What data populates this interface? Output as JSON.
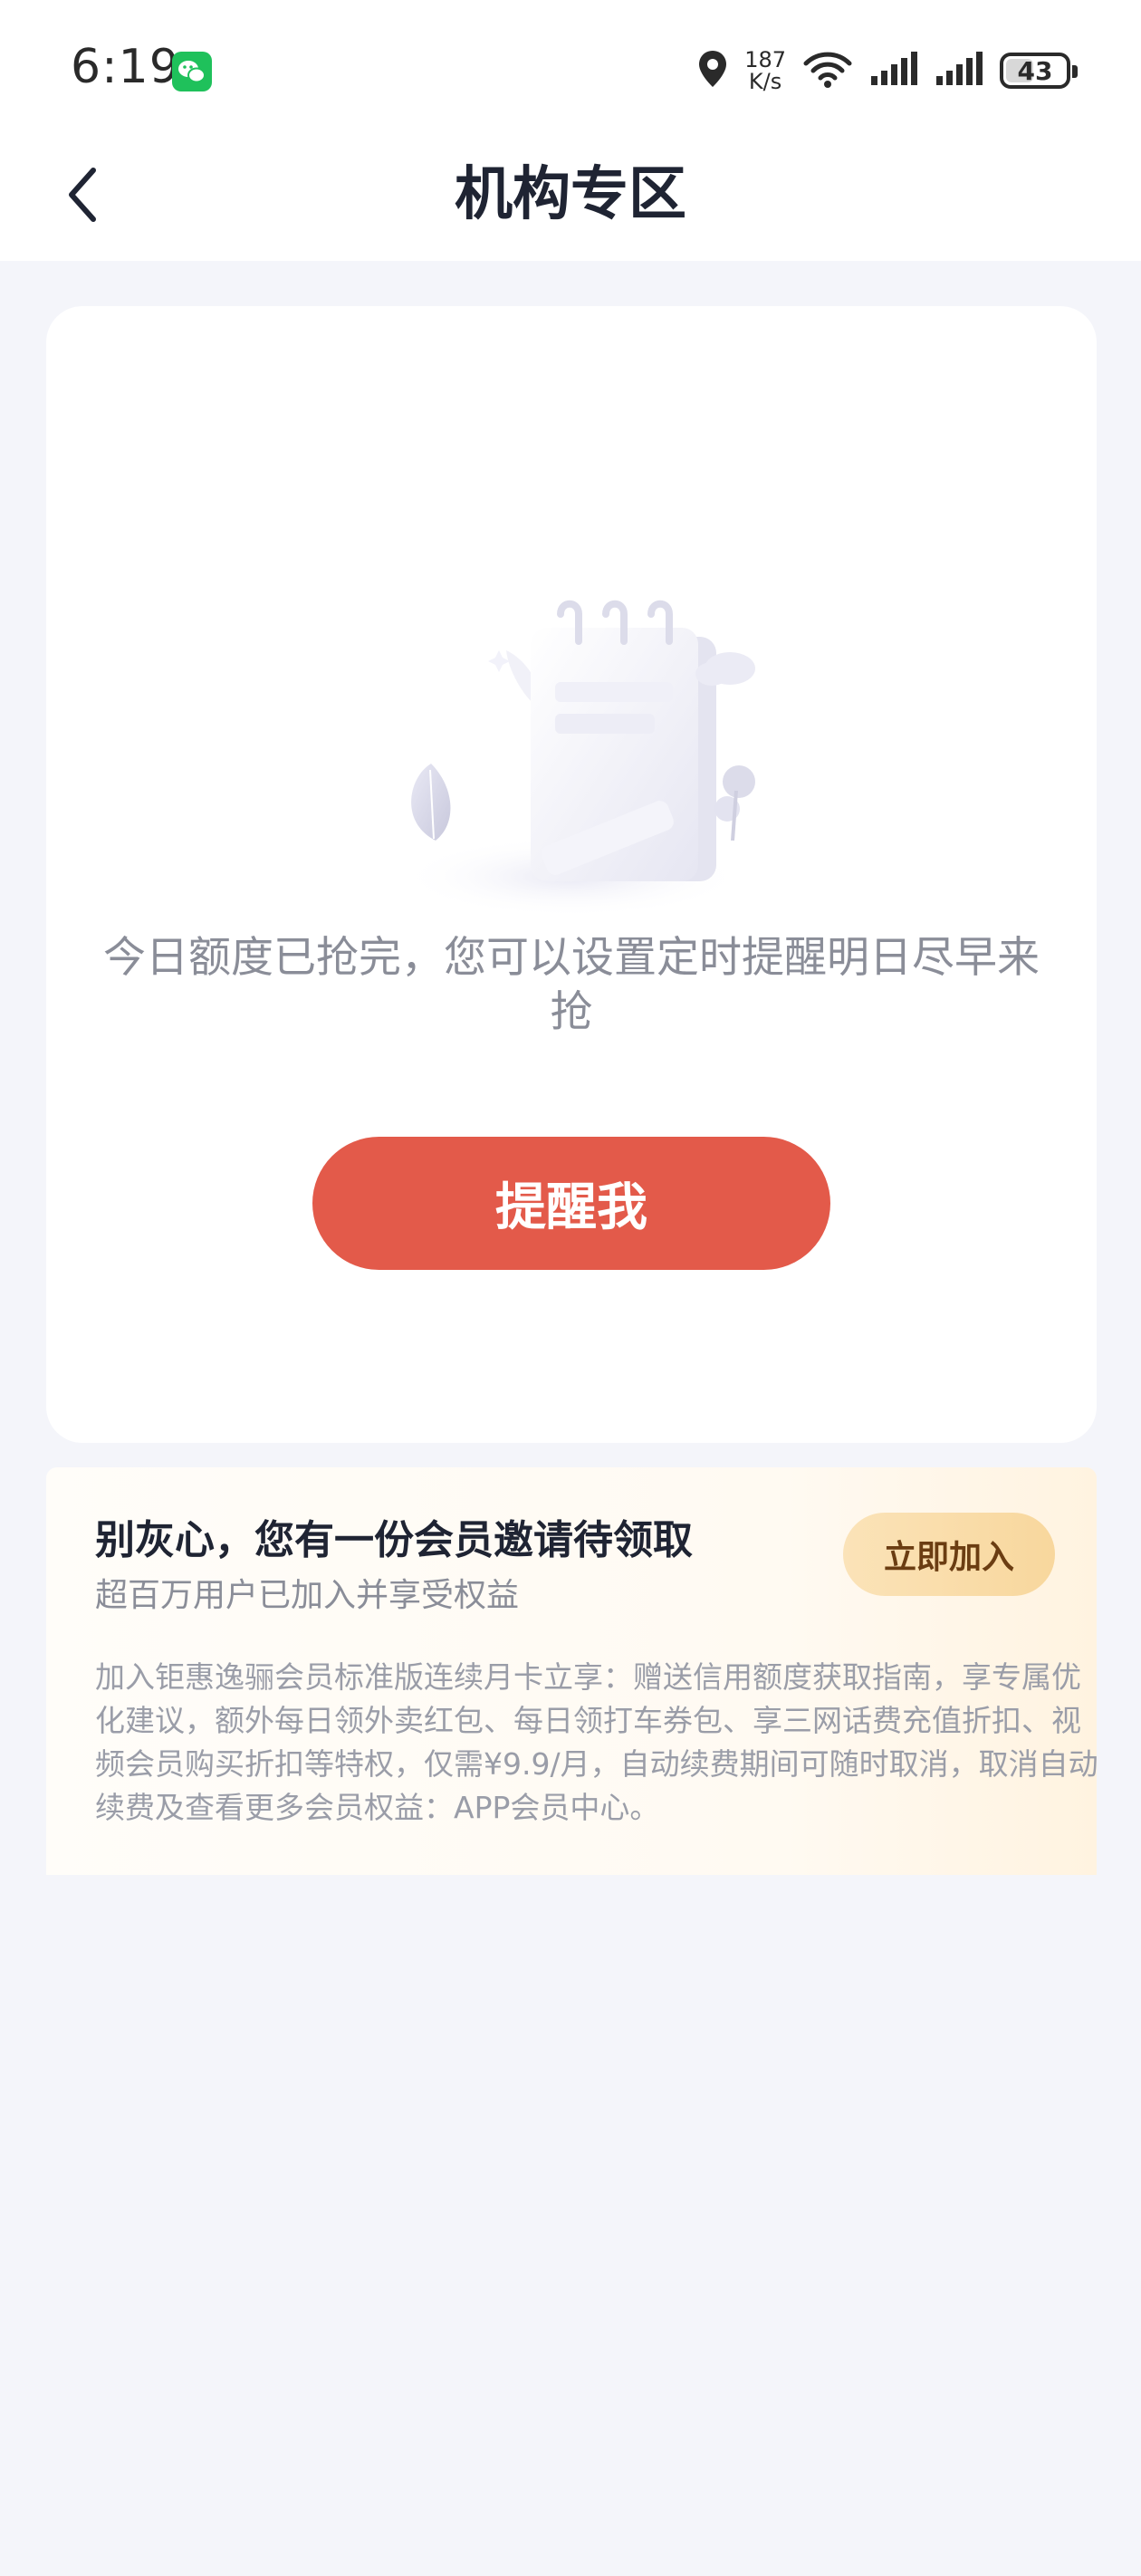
{
  "status_bar": {
    "time": "6:19",
    "net_speed_value": "187",
    "net_speed_unit": "K/s",
    "battery": "43"
  },
  "nav": {
    "title": "机构专区"
  },
  "main_card": {
    "message": "今日额度已抢完，您可以设置定时提醒明日尽早来抢",
    "remind_button": "提醒我"
  },
  "member_card": {
    "title": "别灰心，您有一份会员邀请待领取",
    "subtitle": "超百万用户已加入并享受权益",
    "join_button": "立即加入",
    "description": "加入钜惠逸骊会员标准版连续月卡立享：赠送信用额度获取指南，享专属优化建议，额外每日领外卖红包、每日领打车券包、享三网话费充值折扣、视频会员购买折扣等特权，仅需¥9.9/月，自动续费期间可随时取消，取消自动续费及查看更多会员权益：APP会员中心。"
  },
  "colors": {
    "accent_red": "#e35a4a",
    "gold": "#f8d79d",
    "background": "#f4f5fa"
  }
}
